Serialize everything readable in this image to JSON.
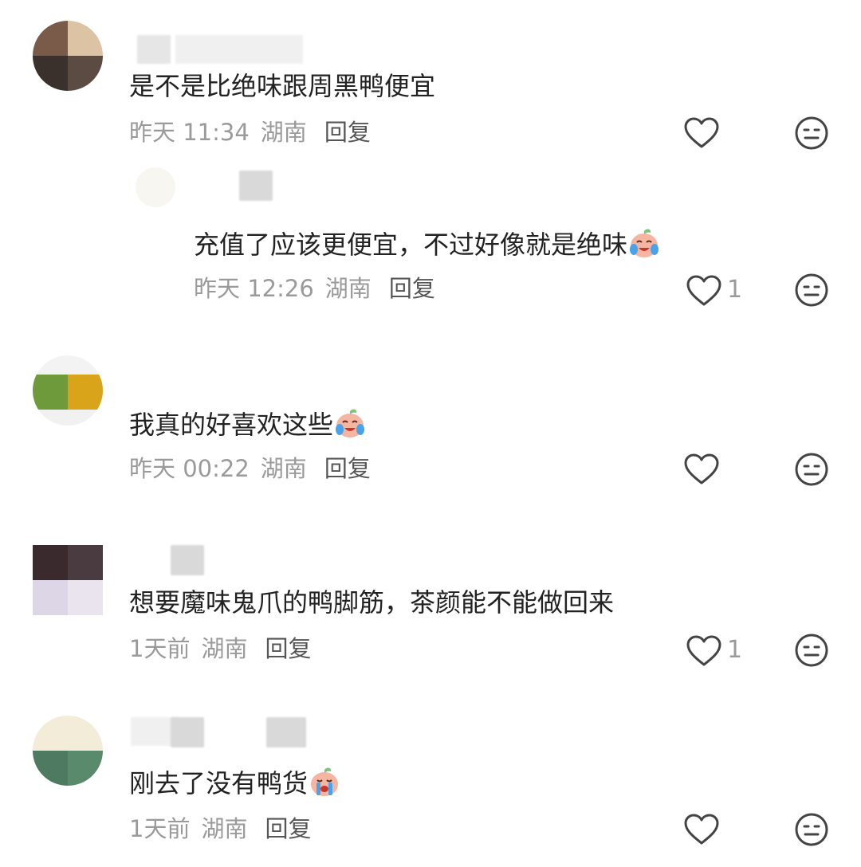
{
  "comments": [
    {
      "text": "是不是比绝味跟周黑鸭便宜",
      "time": "昨天 11:34",
      "location": "湖南",
      "reply_label": "回复",
      "likes": "",
      "emoji": ""
    },
    {
      "text": "充值了应该更便宜，不过好像就是绝味",
      "time": "昨天 12:26",
      "location": "湖南",
      "reply_label": "回复",
      "likes": "1",
      "emoji": "crying-laughing-emoji"
    },
    {
      "text": "我真的好喜欢这些",
      "time": "昨天 00:22",
      "location": "湖南",
      "reply_label": "回复",
      "likes": "",
      "emoji": "crying-laughing-emoji"
    },
    {
      "text": "想要魔味鬼爪的鸭脚筋，茶颜能不能做回来",
      "time": "1天前",
      "location": "湖南",
      "reply_label": "回复",
      "likes": "1",
      "emoji": ""
    },
    {
      "text": "刚去了没有鸭货",
      "time": "1天前",
      "location": "湖南",
      "reply_label": "回复",
      "likes": "",
      "emoji": "crying-emoji"
    }
  ],
  "colors": {
    "text": "#222222",
    "meta": "#9a9a9a",
    "icon": "#444444"
  }
}
